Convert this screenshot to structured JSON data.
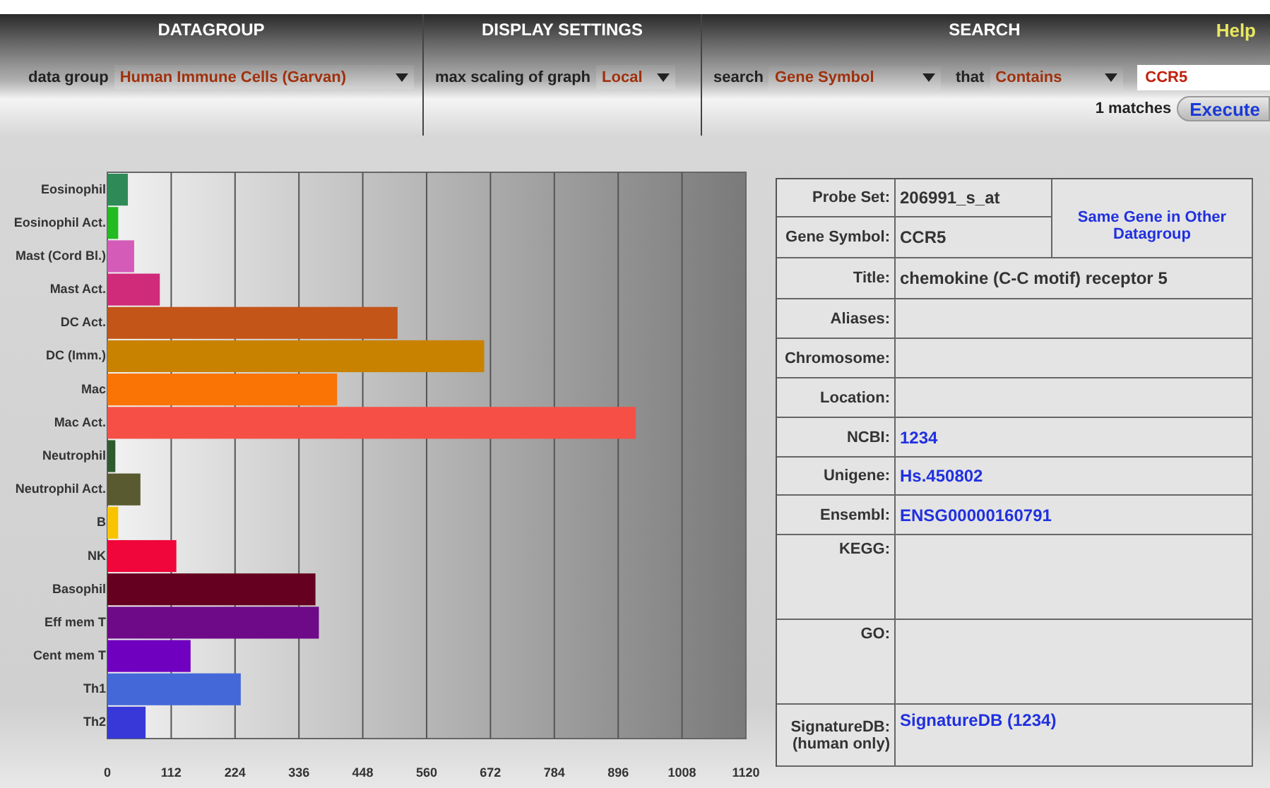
{
  "header": {
    "help": "Help",
    "datagroup": {
      "title": "DATAGROUP",
      "label": "data group",
      "value": "Human Immune Cells (Garvan)"
    },
    "display": {
      "title": "DISPLAY SETTINGS",
      "label": "max scaling of graph",
      "value": "Local"
    },
    "search": {
      "title": "SEARCH",
      "field_label": "search",
      "field_value": "Gene Symbol",
      "match_label": "that",
      "match_value": "Contains",
      "query": "CCR5",
      "matches": "1 matches",
      "execute": "Execute"
    }
  },
  "chart": {
    "chart_data": {
      "type": "bar",
      "orientation": "horizontal",
      "categories": [
        "Eosinophil",
        "Eosinophil Act.",
        "Mast (Cord Bl.)",
        "Mast Act.",
        "DC Act.",
        "DC (Imm.)",
        "Mac",
        "Mac Act.",
        "Neutrophil",
        "Neutrophil Act.",
        "B",
        "NK",
        "Basophil",
        "Eff mem T",
        "Cent mem T",
        "Th1",
        "Th2"
      ],
      "grid": true,
      "series": [
        {
          "values": [
            36,
            19,
            47,
            92,
            509,
            661,
            403,
            927,
            14,
            58,
            19,
            121,
            365,
            371,
            146,
            234,
            67
          ]
        }
      ],
      "colors": [
        "#2e8b57",
        "#22bb22",
        "#d45cb8",
        "#d02a7a",
        "#c45518",
        "#c98200",
        "#f97305",
        "#f65046",
        "#2e5a2e",
        "#5a5a30",
        "#f8c400",
        "#f0063a",
        "#660020",
        "#6e0a88",
        "#7000c0",
        "#4468d8",
        "#3838d8"
      ],
      "xlim": [
        0,
        1120
      ],
      "xticks": [
        0,
        112,
        224,
        336,
        448,
        560,
        672,
        784,
        896,
        1008,
        1120
      ]
    }
  },
  "gene_info": {
    "same_gene_link": "Same Gene in Other Datagroup",
    "rows": [
      {
        "label": "Probe Set:",
        "value": "206991_s_at",
        "kind": "text"
      },
      {
        "label": "Gene Symbol:",
        "value": "CCR5",
        "kind": "text"
      },
      {
        "label": "Title:",
        "value": "chemokine (C-C motif) receptor 5",
        "kind": "text"
      },
      {
        "label": "Aliases:",
        "kind": "text"
      },
      {
        "label": "Chromosome:",
        "kind": "text"
      },
      {
        "label": "Location:",
        "kind": "text"
      },
      {
        "label": "NCBI:",
        "value": "1234",
        "kind": "link"
      },
      {
        "label": "Unigene:",
        "value": "Hs.450802",
        "kind": "link"
      },
      {
        "label": "Ensembl:",
        "value": "ENSG00000160791",
        "kind": "link"
      },
      {
        "label": "KEGG:",
        "kind": "tall"
      },
      {
        "label": "GO:",
        "kind": "tall"
      },
      {
        "label": "SignatureDB:",
        "note": "(human only)",
        "value": "SignatureDB (1234)",
        "kind": "link"
      }
    ]
  }
}
